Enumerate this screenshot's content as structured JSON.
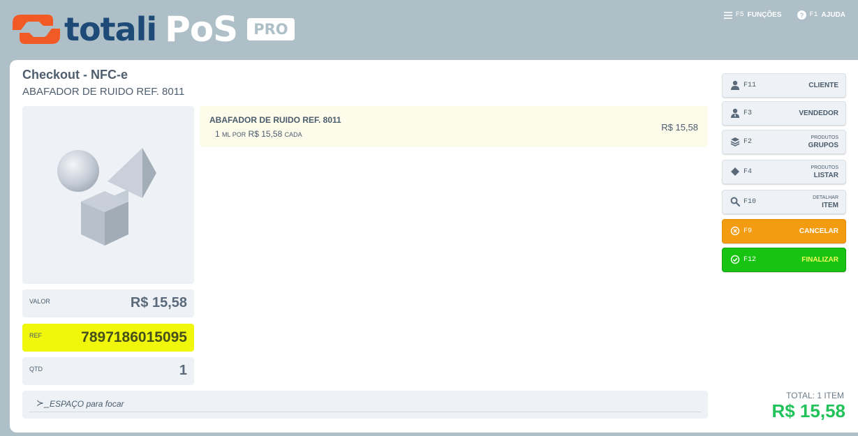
{
  "header": {
    "logo_word": "totali",
    "logo_pos": "PoS",
    "logo_badge": "PRO",
    "actions": [
      {
        "key": "F5",
        "label": "FUNÇÕES",
        "icon": "menu-icon"
      },
      {
        "key": "F1",
        "label": "AJUDA",
        "icon": "help-icon"
      }
    ]
  },
  "checkout": {
    "title": "Checkout - NFC-e",
    "product_name": "ABAFADOR DE RUIDO REF. 8011"
  },
  "fields": {
    "valor_label": "VALOR",
    "valor_value": "R$ 15,58",
    "ref_label": "REF",
    "ref_value": "7897186015095",
    "qtd_label": "QTD",
    "qtd_value": "1"
  },
  "items": [
    {
      "name": "ABAFADOR DE RUIDO REF. 8011",
      "qty": "1",
      "unit": "ML POR",
      "unit_price": "R$ 15,58",
      "cada": "CADA",
      "price": "R$ 15,58"
    }
  ],
  "command": {
    "prompt": "≻_",
    "placeholder": "ESPAÇO para focar"
  },
  "buttons": [
    {
      "key": "F11",
      "label": "CLIENTE",
      "icon": "user-icon"
    },
    {
      "key": "F3",
      "label": "VENDEDOR",
      "icon": "seller-icon"
    },
    {
      "key": "F2",
      "label_small": "PRODUTOS",
      "label": "GRUPOS",
      "icon": "layers-icon"
    },
    {
      "key": "F4",
      "label_small": "PRODUTOS",
      "label": "LISTAR",
      "icon": "diamond-icon"
    },
    {
      "key": "F10",
      "label_small": "DETALHAR",
      "label": "ITEM",
      "icon": "search-icon"
    },
    {
      "key": "F9",
      "label": "CANCELAR",
      "icon": "cancel-icon"
    },
    {
      "key": "F12",
      "label": "FINALIZAR",
      "icon": "check-icon"
    }
  ],
  "total": {
    "label": "TOTAL: 1 ITEM",
    "value": "R$ 15,58"
  },
  "colors": {
    "header_bg": "#aebfc8",
    "logo_orange": "#f15a24",
    "logo_blue": "#1d4a77",
    "ref_highlight": "#f0f70a",
    "cancel": "#f39c12",
    "finalize": "#17c411",
    "total": "#22c25a"
  }
}
